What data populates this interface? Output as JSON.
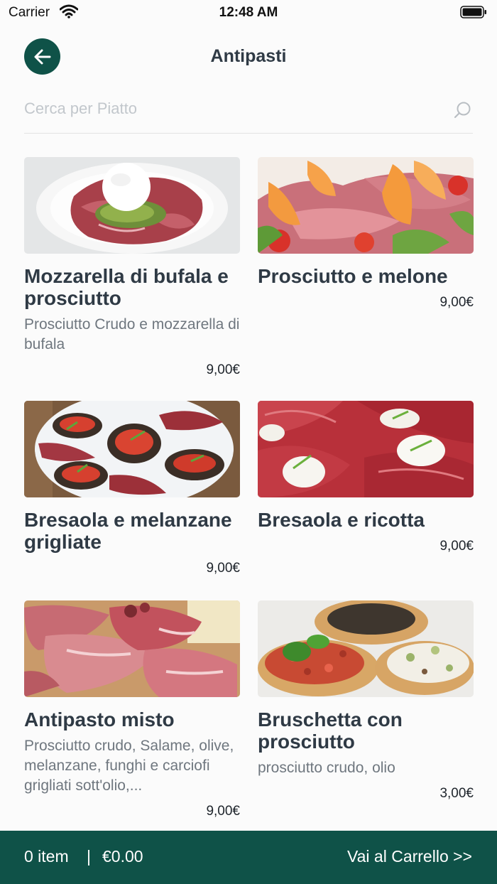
{
  "status": {
    "carrier": "Carrier",
    "time": "12:48 AM"
  },
  "header": {
    "title": "Antipasti",
    "back_icon": "arrow-left-icon"
  },
  "search": {
    "placeholder": "Cerca per Piatto",
    "value": "",
    "icon": "search-icon"
  },
  "items": [
    {
      "name": "Mozzarella di bufala e prosciutto",
      "description": "Prosciutto Crudo e mozzarella di bufala",
      "price": "9,00€"
    },
    {
      "name": "Prosciutto e melone",
      "description": "",
      "price": "9,00€"
    },
    {
      "name": "Bresaola e melanzane grigliate",
      "description": "",
      "price": "9,00€"
    },
    {
      "name": "Bresaola e ricotta",
      "description": "",
      "price": "9,00€"
    },
    {
      "name": "Antipasto misto",
      "description": "Prosciutto crudo, Salame, olive, melanzane, funghi e carciofi grigliati sott'olio,...",
      "price": "9,00€"
    },
    {
      "name": "Bruschetta con prosciutto",
      "description": "prosciutto crudo, olio",
      "price": "3,00€"
    }
  ],
  "cart": {
    "count_label": "0 item",
    "separator": "|",
    "total": "€0.00",
    "button_label": "Vai al Carrello >>"
  },
  "colors": {
    "brand": "#0f5248",
    "title_text": "#2f3a45",
    "muted_text": "#6f777f"
  }
}
